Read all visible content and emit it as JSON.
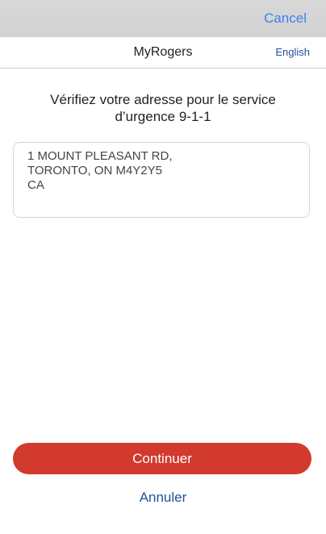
{
  "top_bar": {
    "cancel_label": "Cancel"
  },
  "nav": {
    "title": "MyRogers",
    "language_toggle": "English"
  },
  "main": {
    "heading_line1": "Vérifiez votre adresse pour le service",
    "heading_line2": "d’urgence 9-1-1",
    "address": {
      "line1": "1 MOUNT PLEASANT RD,",
      "line2": "TORONTO, ON M4Y2Y5",
      "line3": "CA"
    }
  },
  "actions": {
    "continue_label": "Continuer",
    "cancel_label": "Annuler"
  },
  "colors": {
    "accent_red": "#d13a2d",
    "link_blue": "#1f4f9c",
    "ios_blue": "#3b82f0"
  }
}
